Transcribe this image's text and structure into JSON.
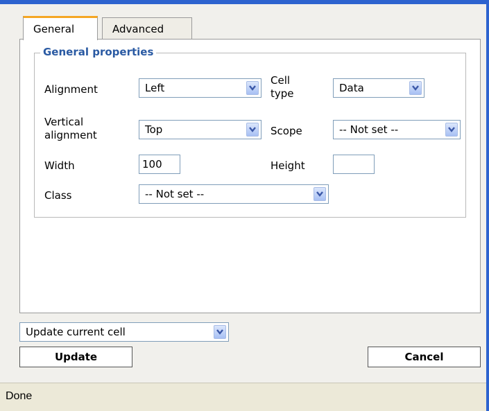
{
  "tabs": [
    {
      "label": "General",
      "active": true
    },
    {
      "label": "Advanced",
      "active": false
    }
  ],
  "general": {
    "legend": "General properties",
    "alignment": {
      "label": "Alignment",
      "value": "Left"
    },
    "cell_type": {
      "label": "Cell type",
      "value": "Data"
    },
    "vertical_alignment": {
      "label": "Vertical alignment",
      "value": "Top"
    },
    "scope": {
      "label": "Scope",
      "value": "-- Not set --"
    },
    "width": {
      "label": "Width",
      "value": "100"
    },
    "height": {
      "label": "Height",
      "value": ""
    },
    "class": {
      "label": "Class",
      "value": "-- Not set --"
    }
  },
  "action": {
    "value": "Update current cell"
  },
  "buttons": {
    "update": "Update",
    "cancel": "Cancel"
  },
  "status": {
    "text": "Done"
  },
  "colors": {
    "accent": "#2d63cf",
    "legend": "#2a5aa3",
    "tab_highlight": "#f5a623",
    "statusbar": "#ece9d8"
  }
}
